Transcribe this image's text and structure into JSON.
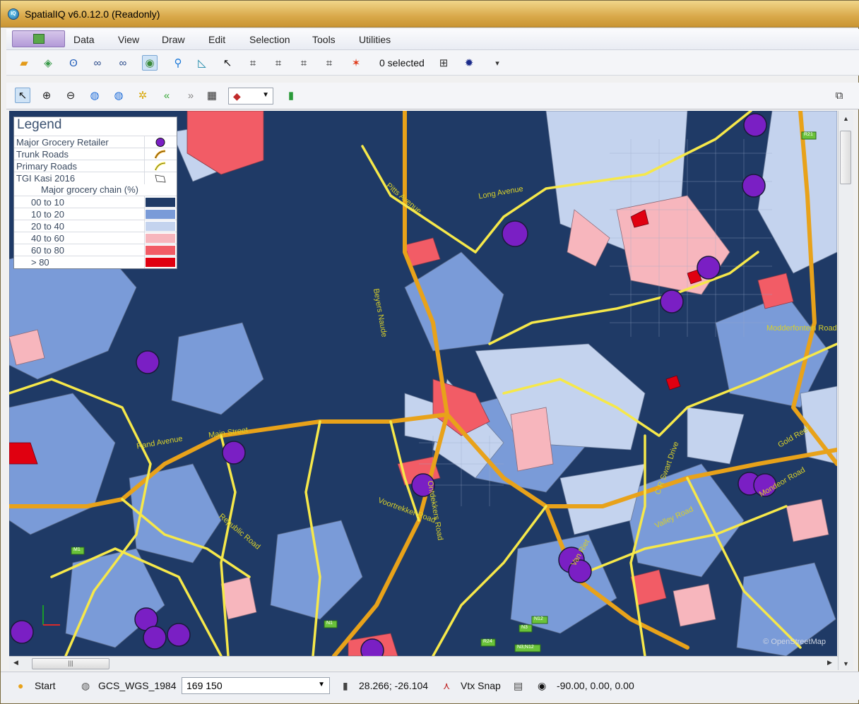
{
  "window": {
    "title": "SpatialIQ v6.0.12.0 (Readonly)"
  },
  "menu": {
    "items": [
      "Data",
      "View",
      "Draw",
      "Edit",
      "Selection",
      "Tools",
      "Utilities"
    ]
  },
  "toolbar": {
    "selected_count": "0 selected"
  },
  "legend": {
    "title": "Legend",
    "layers": [
      "Major Grocery Retailer",
      "Trunk Roads",
      "Primary Roads",
      "TGI Kasi 2016"
    ],
    "theme_title": "Major grocery chain (%)",
    "classes": [
      {
        "label": "00 to 10",
        "color": "#1f3a66"
      },
      {
        "label": "10 to 20",
        "color": "#7a9bd8"
      },
      {
        "label": "20 to 40",
        "color": "#c4d3ee"
      },
      {
        "label": "40 to 60",
        "color": "#f7b6bd"
      },
      {
        "label": "60 to 80",
        "color": "#f25c66"
      },
      {
        "label": "> 80",
        "color": "#e00010"
      }
    ]
  },
  "map": {
    "street_labels": [
      "Main Street",
      "Pitts Avenue",
      "Long Avenue",
      "Valley Road",
      "Van Riet",
      "Gold Reef",
      "Mondeor Road",
      "Ontdekkers Road",
      "Voortrekker Road",
      "Beyers Naude",
      "Rand Avenue",
      "Modderfontein Road",
      "C R Swart Drive",
      "Republic Road"
    ],
    "route_shields": [
      "R21",
      "M1",
      "N1",
      "N3",
      "N12",
      "R24",
      "N3;N12"
    ],
    "attribution": "© OpenStreetMap",
    "retailer_color": "#7a1fc4"
  },
  "statusbar": {
    "start": "Start",
    "crs": "GCS_WGS_1984",
    "scale": "169 150",
    "coordinates": "28.266; -26.104",
    "snap": "Vtx Snap",
    "rotation": "-90.00, 0.00, 0.00"
  }
}
